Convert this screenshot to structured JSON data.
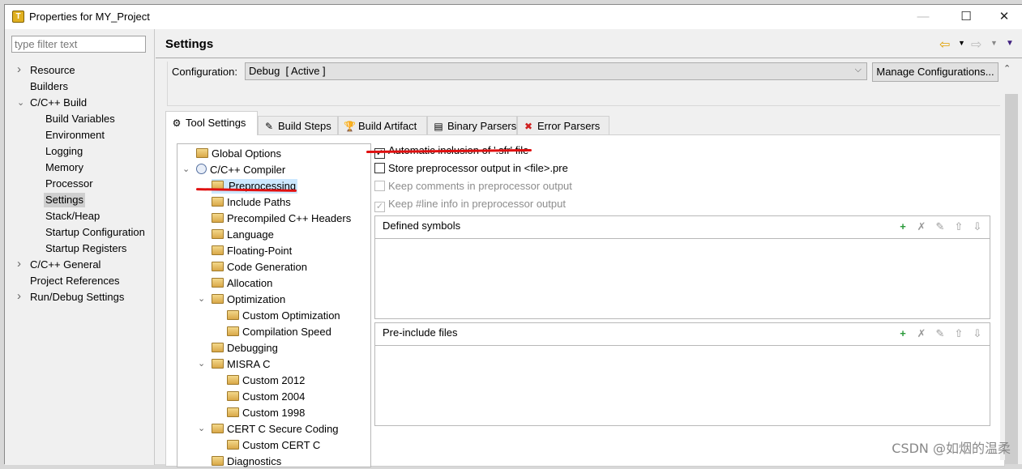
{
  "window": {
    "title": "Properties for MY_Project",
    "app_icon_letter": "T"
  },
  "filter": {
    "placeholder": "type filter text"
  },
  "nav": [
    {
      "label": "Resource",
      "level": 0,
      "chevron": "right"
    },
    {
      "label": "Builders",
      "level": 0
    },
    {
      "label": "C/C++ Build",
      "level": 0,
      "chevron": "down"
    },
    {
      "label": "Build Variables",
      "level": 1
    },
    {
      "label": "Environment",
      "level": 1
    },
    {
      "label": "Logging",
      "level": 1
    },
    {
      "label": "Memory",
      "level": 1
    },
    {
      "label": "Processor",
      "level": 1
    },
    {
      "label": "Settings",
      "level": 1,
      "selected": true
    },
    {
      "label": "Stack/Heap",
      "level": 1
    },
    {
      "label": "Startup Configuration",
      "level": 1
    },
    {
      "label": "Startup Registers",
      "level": 1
    },
    {
      "label": "C/C++ General",
      "level": 0,
      "chevron": "right"
    },
    {
      "label": "Project References",
      "level": 0
    },
    {
      "label": "Run/Debug Settings",
      "level": 0,
      "chevron": "right"
    }
  ],
  "page": {
    "title": "Settings"
  },
  "config": {
    "label": "Configuration:",
    "value": "Debug  [ Active ]",
    "manage_label": "Manage Configurations..."
  },
  "tabs": [
    {
      "label": "Tool Settings",
      "icon": "tool-settings-icon",
      "glyph": "⚙",
      "active": true
    },
    {
      "label": "Build Steps",
      "icon": "build-steps-icon",
      "glyph": "✎"
    },
    {
      "label": "Build Artifact",
      "icon": "trophy-icon",
      "glyph": "🏆"
    },
    {
      "label": "Binary Parsers",
      "icon": "binary-icon",
      "glyph": "▤"
    },
    {
      "label": "Error Parsers",
      "icon": "error-icon",
      "glyph": "✖"
    }
  ],
  "tool_tree": [
    {
      "label": "Global Options",
      "level": 0
    },
    {
      "label": "C/C++ Compiler",
      "level": 0,
      "chevron": "down",
      "gear": true
    },
    {
      "label": "Preprocessing",
      "level": 1,
      "selected": true
    },
    {
      "label": "Include Paths",
      "level": 1
    },
    {
      "label": "Precompiled C++ Headers",
      "level": 1
    },
    {
      "label": "Language",
      "level": 1
    },
    {
      "label": "Floating-Point",
      "level": 1
    },
    {
      "label": "Code Generation",
      "level": 1
    },
    {
      "label": "Allocation",
      "level": 1
    },
    {
      "label": "Optimization",
      "level": 1,
      "chevron": "down"
    },
    {
      "label": "Custom Optimization",
      "level": 2
    },
    {
      "label": "Compilation Speed",
      "level": 2
    },
    {
      "label": "Debugging",
      "level": 1
    },
    {
      "label": "MISRA C",
      "level": 1,
      "chevron": "down"
    },
    {
      "label": "Custom 2012",
      "level": 2
    },
    {
      "label": "Custom 2004",
      "level": 2
    },
    {
      "label": "Custom 1998",
      "level": 2
    },
    {
      "label": "CERT C Secure Coding",
      "level": 1,
      "chevron": "down"
    },
    {
      "label": "Custom CERT C",
      "level": 2
    },
    {
      "label": "Diagnostics",
      "level": 1
    }
  ],
  "options": [
    {
      "label": "Automatic inclusion of '.sfr' file",
      "checked": true,
      "enabled": true
    },
    {
      "label": "Store preprocessor output in <file>.pre",
      "checked": false,
      "enabled": true
    },
    {
      "label": "Keep comments in preprocessor output",
      "checked": false,
      "enabled": false
    },
    {
      "label": "Keep #line info in preprocessor output",
      "checked": true,
      "enabled": false
    }
  ],
  "groups": [
    {
      "title": "Defined symbols"
    },
    {
      "title": "Pre-include files"
    }
  ],
  "annotation_color": "#e01010",
  "watermark": "CSDN @如烟的温柔"
}
